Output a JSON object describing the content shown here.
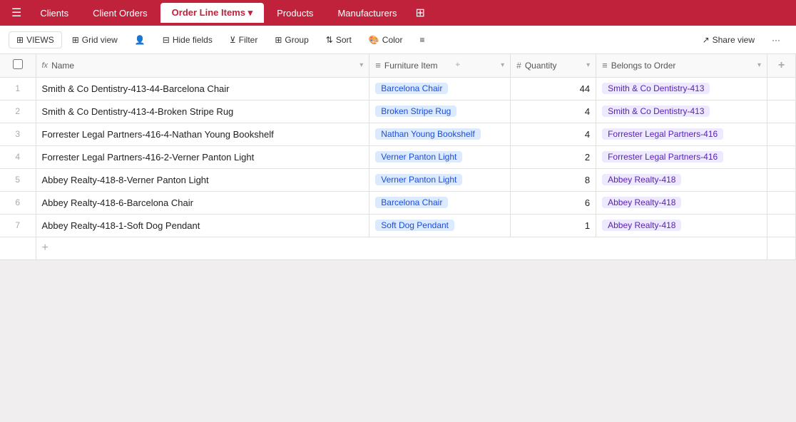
{
  "topNav": {
    "hamburger": "☰",
    "tabs": [
      {
        "id": "clients",
        "label": "Clients",
        "active": false
      },
      {
        "id": "client-orders",
        "label": "Client Orders",
        "active": false
      },
      {
        "id": "order-line-items",
        "label": "Order Line Items ▾",
        "active": true
      },
      {
        "id": "products",
        "label": "Products",
        "active": false
      },
      {
        "id": "manufacturers",
        "label": "Manufacturers",
        "active": false
      }
    ],
    "plus_icon": "⊞"
  },
  "toolbar": {
    "views_label": "VIEWS",
    "grid_view_label": "Grid view",
    "hide_fields_label": "Hide fields",
    "filter_label": "Filter",
    "group_label": "Group",
    "sort_label": "Sort",
    "color_label": "Color",
    "density_icon": "≡",
    "share_view_label": "Share view",
    "more_icon": "···"
  },
  "table": {
    "columns": [
      {
        "id": "name",
        "icon": "fx",
        "label": "Name",
        "dropdown": true
      },
      {
        "id": "furniture_item",
        "icon": "≡",
        "label": "Furniture Item",
        "dropdown": true
      },
      {
        "id": "quantity",
        "icon": "#",
        "label": "Quantity",
        "dropdown": true
      },
      {
        "id": "belongs_to_order",
        "icon": "≡",
        "label": "Belongs to Order",
        "dropdown": true
      }
    ],
    "rows": [
      {
        "num": "1",
        "name": "Smith & Co Dentistry-413-44-Barcelona Chair",
        "furniture_item": "Barcelona Chair",
        "furniture_tag": "tag-blue",
        "quantity": "44",
        "belongs_to_order": "Smith & Co Dentistry-413",
        "order_tag": "tag-gray"
      },
      {
        "num": "2",
        "name": "Smith & Co Dentistry-413-4-Broken Stripe Rug",
        "furniture_item": "Broken Stripe Rug",
        "furniture_tag": "tag-blue",
        "quantity": "4",
        "belongs_to_order": "Smith & Co Dentistry-413",
        "order_tag": "tag-gray"
      },
      {
        "num": "3",
        "name": "Forrester Legal Partners-416-4-Nathan Young Bookshelf",
        "furniture_item": "Nathan Young Bookshelf",
        "furniture_tag": "tag-blue",
        "quantity": "4",
        "belongs_to_order": "Forrester Legal Partners-416",
        "order_tag": "tag-gray"
      },
      {
        "num": "4",
        "name": "Forrester Legal Partners-416-2-Verner Panton Light",
        "furniture_item": "Verner Panton Light",
        "furniture_tag": "tag-blue",
        "quantity": "2",
        "belongs_to_order": "Forrester Legal Partners-416",
        "order_tag": "tag-gray"
      },
      {
        "num": "5",
        "name": "Abbey Realty-418-8-Verner Panton Light",
        "furniture_item": "Verner Panton Light",
        "furniture_tag": "tag-blue",
        "quantity": "8",
        "belongs_to_order": "Abbey Realty-418",
        "order_tag": "tag-gray"
      },
      {
        "num": "6",
        "name": "Abbey Realty-418-6-Barcelona Chair",
        "furniture_item": "Barcelona Chair",
        "furniture_tag": "tag-blue",
        "quantity": "6",
        "belongs_to_order": "Abbey Realty-418",
        "order_tag": "tag-gray"
      },
      {
        "num": "7",
        "name": "Abbey Realty-418-1-Soft Dog Pendant",
        "furniture_item": "Soft Dog Pendant",
        "furniture_tag": "tag-blue",
        "quantity": "1",
        "belongs_to_order": "Abbey Realty-418",
        "order_tag": "tag-gray"
      }
    ],
    "add_row_label": "+",
    "add_col_label": "+"
  }
}
